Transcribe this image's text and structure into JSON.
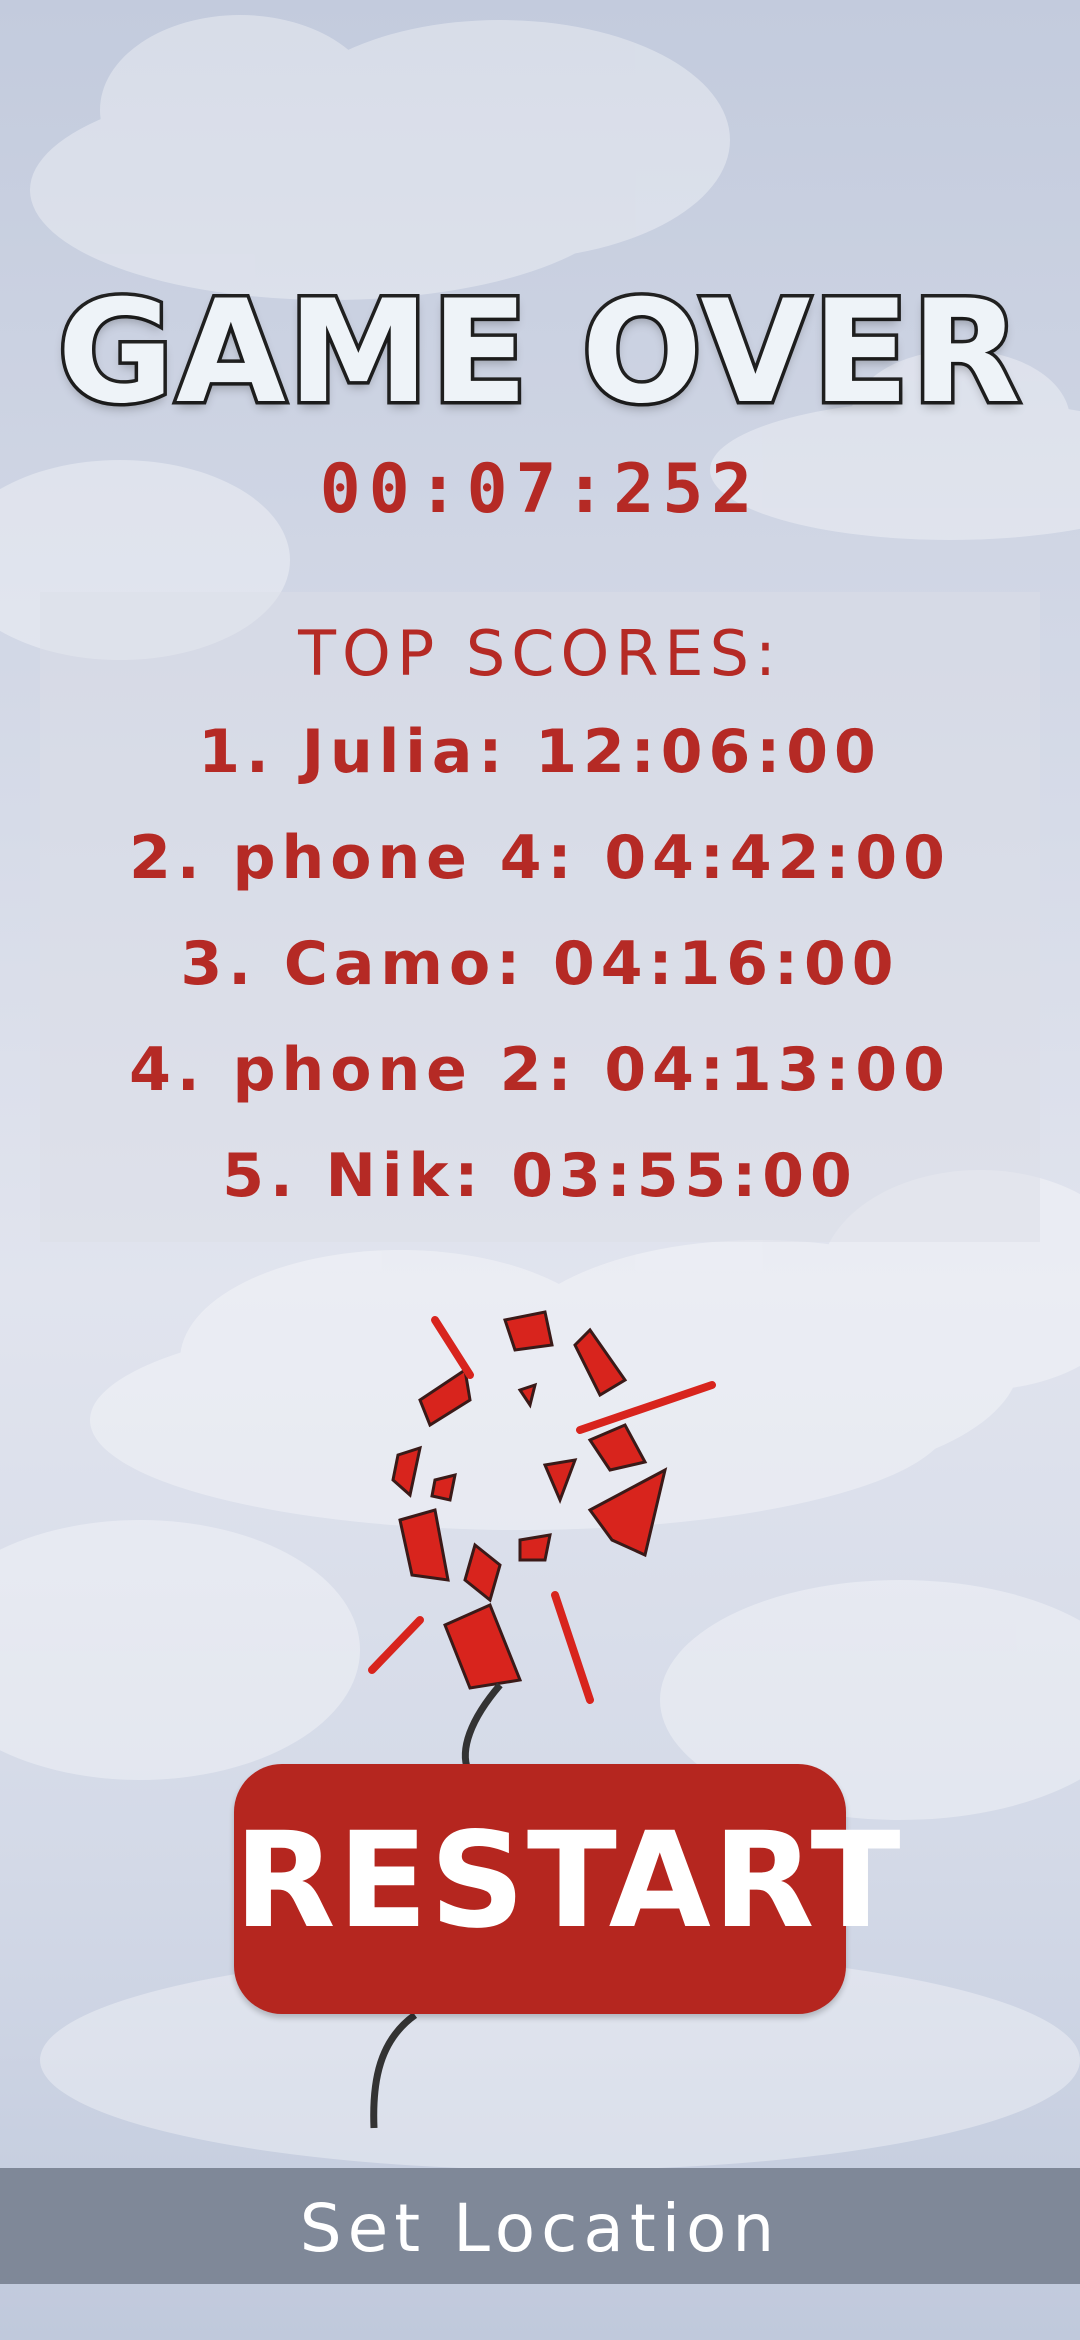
{
  "game": {
    "title": "GAME OVER",
    "time": "00:07:252"
  },
  "scores": {
    "title": "TOP SCORES:",
    "rows": [
      "1. Julia: 12:06:00",
      "2. phone 4: 04:42:00",
      "3. Camo: 04:16:00",
      "4. phone 2: 04:13:00",
      "5. Nik: 03:55:00"
    ]
  },
  "actions": {
    "restart_label": "RESTART",
    "location_label": "Set Location"
  },
  "colors": {
    "accent_red": "#b5261f",
    "score_text": "#b52a25",
    "location_bar": "#7f8898"
  },
  "icons": {
    "balloon": "popped-balloon-icon"
  }
}
